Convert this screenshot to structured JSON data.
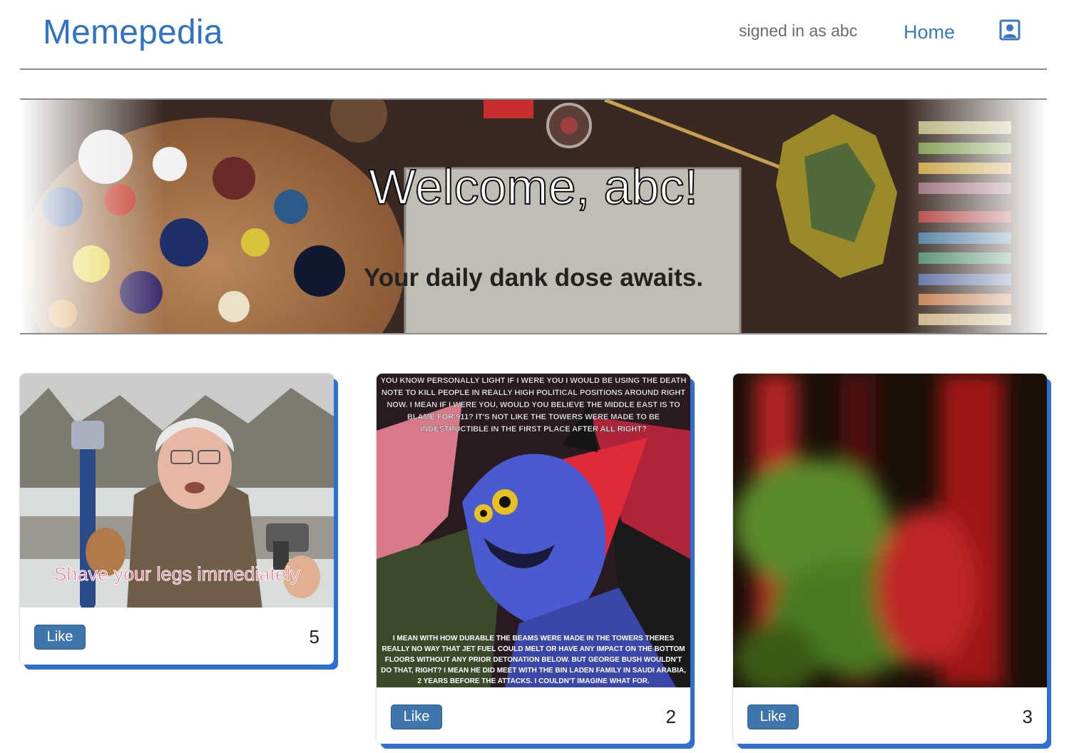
{
  "header": {
    "logo": "Memepedia",
    "signed_in": "signed in as abc",
    "home_label": "Home",
    "profile_icon": "user-portrait-icon"
  },
  "hero": {
    "title": "Welcome, abc!",
    "subtitle": "Your daily dank dose awaits."
  },
  "posts": [
    {
      "caption": "Shave your legs immediately",
      "like_label": "Like",
      "likes": "5"
    },
    {
      "top_text": "YOU KNOW PERSONALLY LIGHT IF I WERE YOU I WOULD BE USING THE DEATH NOTE TO KILL PEOPLE IN REALLY HIGH POLITICAL POSITIONS AROUND RIGHT NOW. I MEAN IF I WERE YOU, WOULD YOU BELIEVE THE MIDDLE EAST IS TO BLAME FOR 911? IT'S NOT LIKE THE TOWERS WERE MADE TO BE INDESTRUCTIBLE IN THE FIRST PLACE AFTER ALL RIGHT?",
      "bottom_text": "I MEAN WITH HOW DURABLE THE BEAMS WERE MADE IN THE TOWERS THERES REALLY NO WAY THAT JET FUEL COULD MELT OR HAVE ANY IMPACT ON THE BOTTOM FLOORS WITHOUT ANY PRIOR DETONATION BELOW. BUT GEORGE BUSH WOULDN'T DO THAT, RIGHT? I MEAN HE DID MEET WITH THE BIN LADEN FAMILY IN SAUDI ARABIA, 2 YEARS BEFORE THE ATTACKS. I COULDN'T IMAGINE WHAT FOR.",
      "like_label": "Like",
      "likes": "2"
    },
    {
      "like_label": "Like",
      "likes": "3"
    }
  ],
  "colors": {
    "brand": "#2f72c6",
    "button": "#3f75ad",
    "card_shadow": "#2f6fd0"
  }
}
